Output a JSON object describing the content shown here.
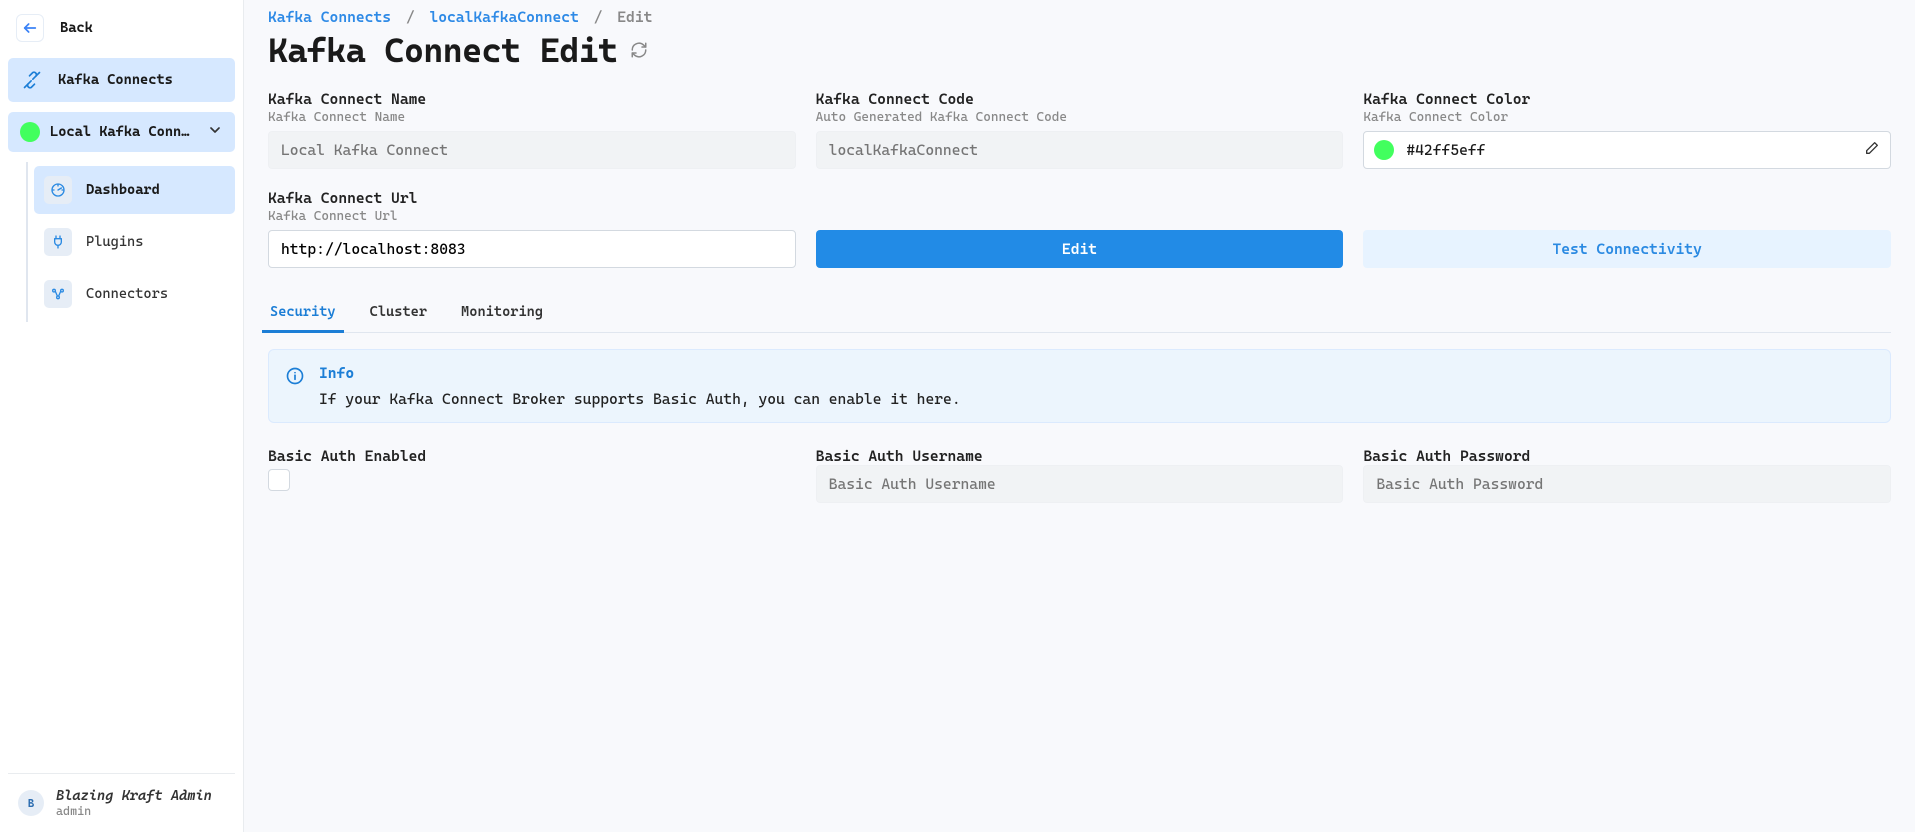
{
  "sidebar": {
    "back_label": "Back",
    "kafka_connects_label": "Kafka Connects",
    "cluster_label": "Local Kafka Conne…",
    "cluster_color": "#42ff5e",
    "items": [
      {
        "label": "Dashboard",
        "active": true
      },
      {
        "label": "Plugins",
        "active": false
      },
      {
        "label": "Connectors",
        "active": false
      }
    ],
    "footer_name": "Blazing Kraft Admin",
    "footer_role": "admin",
    "footer_initial": "B"
  },
  "breadcrumb": {
    "root": "Kafka Connects",
    "cluster": "localKafkaConnect",
    "current": "Edit"
  },
  "page_title": "Kafka Connect Edit",
  "fields": {
    "name": {
      "label": "Kafka Connect Name",
      "sub": "Kafka Connect Name",
      "placeholder": "Local Kafka Connect"
    },
    "code": {
      "label": "Kafka Connect Code",
      "sub": "Auto Generated Kafka Connect Code",
      "placeholder": "localKafkaConnect"
    },
    "color": {
      "label": "Kafka Connect Color",
      "sub": "Kafka Connect Color",
      "value": "#42ff5eff"
    },
    "url": {
      "label": "Kafka Connect Url",
      "sub": "Kafka Connect Url",
      "value": "http://localhost:8083"
    }
  },
  "buttons": {
    "edit": "Edit",
    "test_connectivity": "Test Connectivity"
  },
  "tabs": [
    {
      "label": "Security",
      "active": true
    },
    {
      "label": "Cluster",
      "active": false
    },
    {
      "label": "Monitoring",
      "active": false
    }
  ],
  "info": {
    "title": "Info",
    "body": "If your Kafka Connect Broker supports Basic Auth, you can enable it here."
  },
  "basic_auth": {
    "enabled_label": "Basic Auth Enabled",
    "username_label": "Basic Auth Username",
    "username_placeholder": "Basic Auth Username",
    "password_label": "Basic Auth Password",
    "password_placeholder": "Basic Auth Password"
  }
}
